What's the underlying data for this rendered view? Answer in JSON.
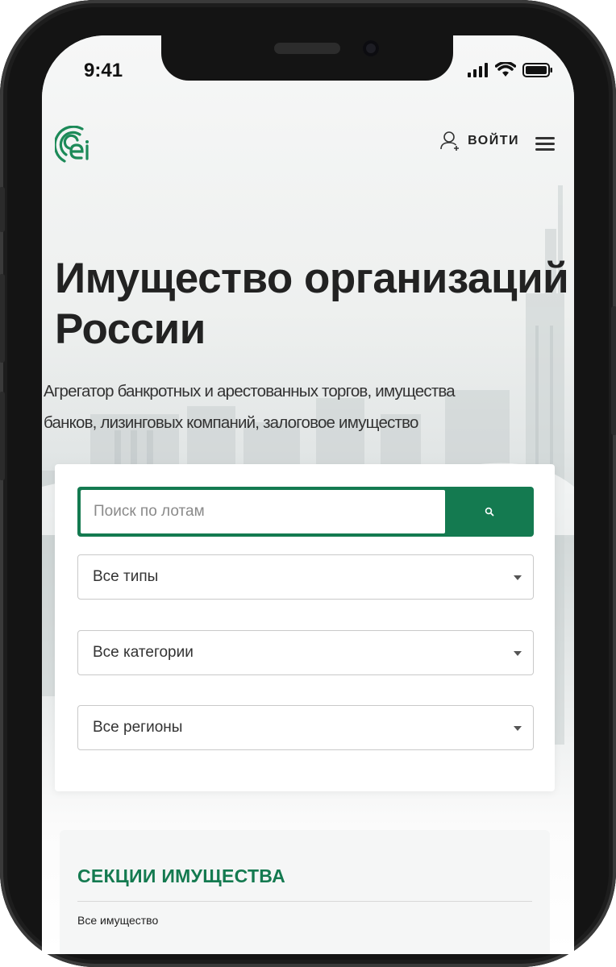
{
  "status_bar": {
    "time": "9:41",
    "icons": [
      "signal-icon",
      "wifi-icon",
      "battery-icon"
    ]
  },
  "header": {
    "logo": "ei-logo",
    "login_label": "войти",
    "login_icon": "user-add-icon",
    "menu_icon": "hamburger-menu-icon"
  },
  "hero": {
    "title_line1": "Имущество организаций",
    "title_line2": "России",
    "subtitle_line1": "Агрегатор банкротных и арестованных торгов, имущества",
    "subtitle_line2": "банков, лизинговых компаний, залоговое имущество"
  },
  "search": {
    "placeholder": "Поиск по лотам",
    "button_icon": "search-icon",
    "filters": [
      {
        "selected": "Все типы"
      },
      {
        "selected": "Все категории"
      },
      {
        "selected": "Все регионы"
      }
    ]
  },
  "sections": {
    "title": "СЕКЦИИ ИМУЩЕСТВА",
    "items": [
      "Все имущество"
    ]
  },
  "colors": {
    "accent": "#147a50",
    "text": "#222222",
    "placeholder": "#8a8a8a"
  }
}
